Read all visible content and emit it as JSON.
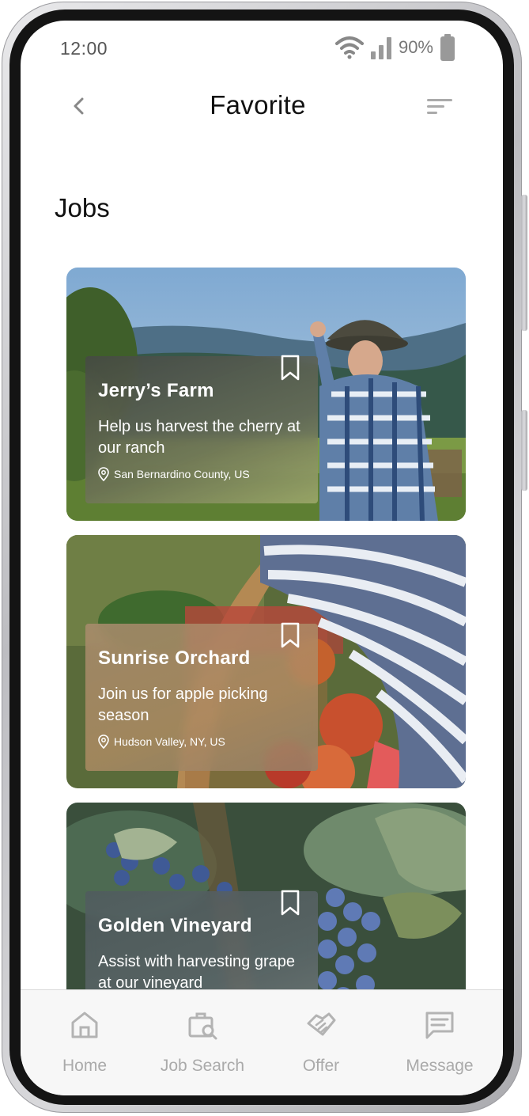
{
  "status_bar": {
    "time": "12:00",
    "battery_percent": "90%",
    "icons": [
      "wifi-icon",
      "signal-icon",
      "battery-icon"
    ]
  },
  "header": {
    "title": "Favorite",
    "back_icon": "chevron-left-icon",
    "sort_icon": "sort-icon"
  },
  "section": {
    "title": "Jobs"
  },
  "jobs": [
    {
      "name": "Jerry’s Farm",
      "description": "Help us harvest the cherry at our ranch",
      "location": "San Bernardino County, US",
      "bookmark_icon": "bookmark-icon"
    },
    {
      "name": "Sunrise Orchard",
      "description": "Join us for apple picking season",
      "location": "Hudson Valley, NY, US",
      "bookmark_icon": "bookmark-icon"
    },
    {
      "name": "Golden Vineyard",
      "description": "Assist with harvesting grape at our vineyard",
      "location": "",
      "bookmark_icon": "bookmark-icon"
    }
  ],
  "bottom_nav": [
    {
      "label": "Home",
      "icon": "home-icon"
    },
    {
      "label": "Job Search",
      "icon": "job-search-icon"
    },
    {
      "label": "Offer",
      "icon": "handshake-icon"
    },
    {
      "label": "Message",
      "icon": "message-icon"
    }
  ],
  "colors": {
    "text_primary": "#111111",
    "nav_inactive": "#aaaaaa",
    "status_gray": "#777777"
  }
}
